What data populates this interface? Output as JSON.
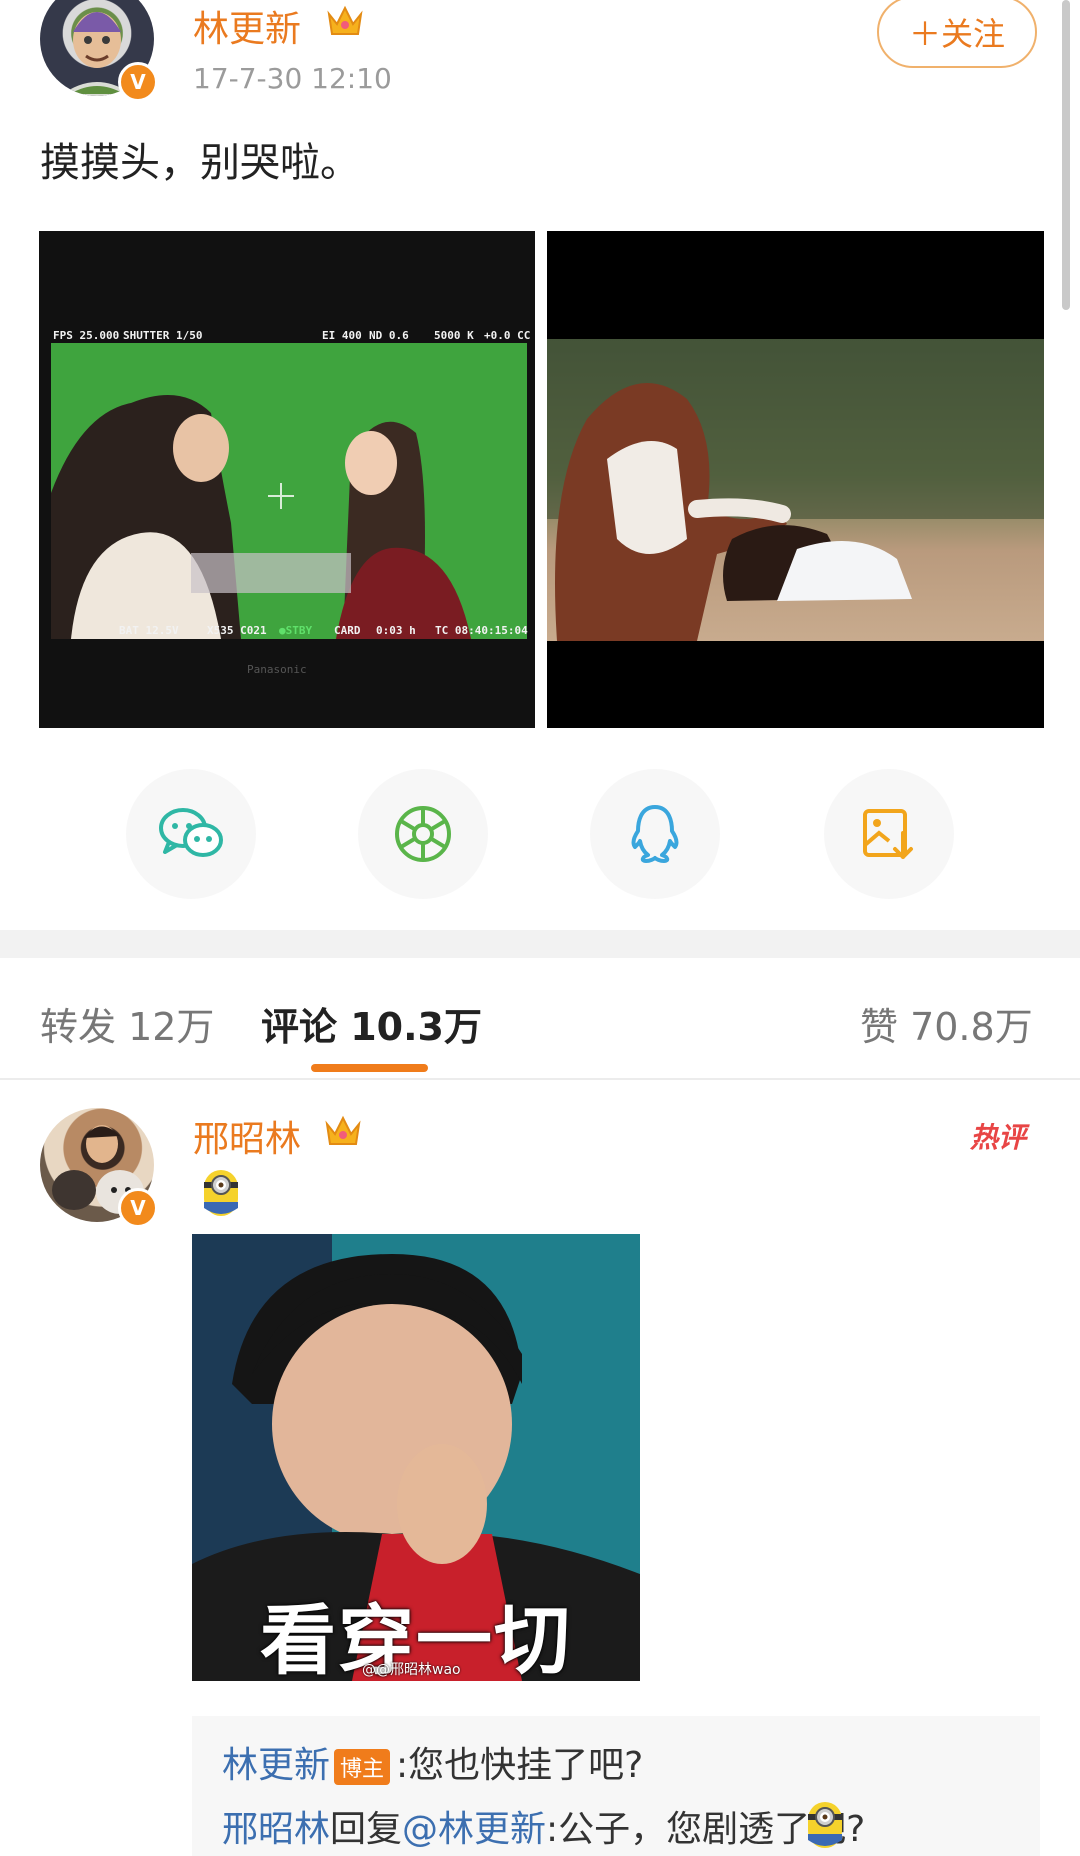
{
  "post": {
    "author": "林更新",
    "timestamp": "17-7-30 12:10",
    "follow_label": "＋关注",
    "text": "摸摸头，别哭啦。",
    "verified_mark": "V",
    "images": [
      {
        "osd": {
          "fps": "FPS 25.000",
          "shutter": "SHUTTER 1/50",
          "ei": "EI 400",
          "nd": "ND 0.6",
          "wb": "5000 K",
          "cc": "+0.0 CC",
          "bat": "BAT 12.5V",
          "clip": "X535  C021",
          "stby": "●STBY",
          "card": "CARD",
          "hours": "0:03 h",
          "tc": "TC 08:40:15:04",
          "brand": "Panasonic"
        }
      },
      {}
    ]
  },
  "share": {
    "icons": [
      "wechat-icon",
      "moments-icon",
      "qq-icon",
      "save-image-icon"
    ]
  },
  "tabs": {
    "repost": "转发 12万",
    "comments": "评论 10.3万",
    "likes": "赞 70.8万"
  },
  "comment": {
    "author": "邢昭林",
    "hot_label": "热评",
    "meme_caption": "看穿一切",
    "meme_watermark": "@@邢昭林wao",
    "replies": [
      {
        "name": "林更新",
        "badge": "博主",
        "text": ":您也快挂了吧?"
      },
      {
        "name": "邢昭林",
        "reply_word": "回复",
        "mention": "@林更新",
        "text": ":公子，您剧透了吧?"
      }
    ]
  },
  "colors": {
    "accent": "#ea7a1f",
    "link": "#3c6fb0",
    "hot": "#e84545",
    "wechat": "#2fb7a5",
    "moments": "#5ab54a",
    "qq": "#3aa6dd",
    "save": "#f2a51c"
  }
}
